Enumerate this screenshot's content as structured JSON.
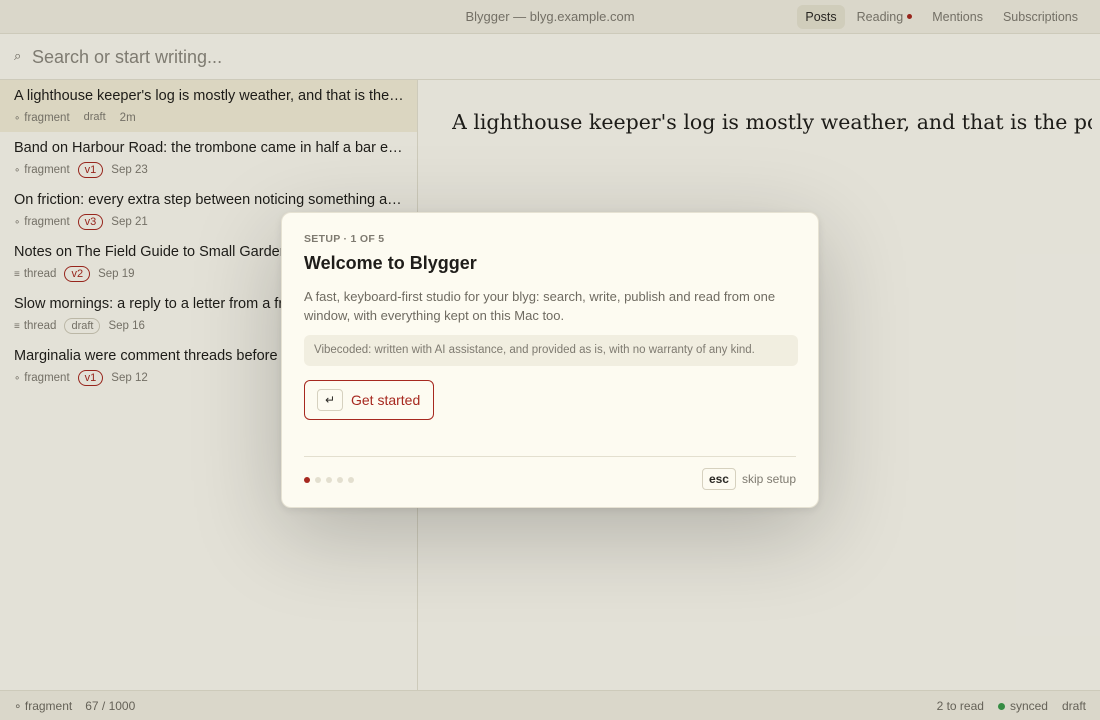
{
  "window": {
    "title": "Blygger — blyg.example.com"
  },
  "nav": {
    "tabs": [
      {
        "label": "Posts",
        "active": true
      },
      {
        "label": "Reading",
        "unread_indicator": true
      },
      {
        "label": "Mentions"
      },
      {
        "label": "Subscriptions"
      }
    ]
  },
  "search": {
    "placeholder": "Search or start writing...",
    "icon": "search-icon",
    "glyph": "⌕"
  },
  "posts": [
    {
      "title": "A lighthouse keeper's log is mostly weather, and that is the point.",
      "type_glyph": "∘",
      "type": "fragment",
      "status": "draft",
      "status_style": "label",
      "date": "2m",
      "selected": true
    },
    {
      "title": "Band on Harbour Road: the trombone came in half a bar early",
      "type_glyph": "∘",
      "type": "fragment",
      "status": "v1",
      "status_style": "version",
      "date": "Sep 23"
    },
    {
      "title": "On friction: every extra step between noticing something and writing it",
      "type_glyph": "∘",
      "type": "fragment",
      "status": "v3",
      "status_style": "version",
      "date": "Sep 21"
    },
    {
      "title": "Notes on The Field Guide to Small Gardens",
      "type_glyph": "≡",
      "type": "thread",
      "status": "v2",
      "status_style": "version",
      "date": "Sep 19"
    },
    {
      "title": "Slow mornings: a reply to a letter from a friend",
      "type_glyph": "≡",
      "type": "thread",
      "status": "draft",
      "status_style": "pill",
      "date": "Sep 16"
    },
    {
      "title": "Marginalia were comment threads before the web",
      "type_glyph": "∘",
      "type": "fragment",
      "status": "v1",
      "status_style": "version",
      "date": "Sep 12"
    }
  ],
  "reader": {
    "title": "A lighthouse keeper's log is mostly weather, and that is the point."
  },
  "status": {
    "type_glyph": "∘",
    "type": "fragment",
    "char_count": "67 / 1000",
    "to_read": "2 to read",
    "sync": "synced",
    "state": "draft"
  },
  "modal": {
    "step": "SETUP · 1 OF 5",
    "title": "Welcome to Blygger",
    "description": "A fast, keyboard-first studio for your blyg: search, write, publish and read from one window, with everything kept on this Mac too.",
    "disclaimer": "Vibecoded: written with AI assistance, and provided as is, with no warranty of any kind.",
    "primary_key": "↵",
    "primary_label": "Get started",
    "progress": {
      "current": 1,
      "total": 5
    },
    "skip_key": "esc",
    "skip_label": "skip setup"
  },
  "colors": {
    "accent": "#a6281f",
    "background": "#fbf9ef",
    "bar": "#f1eee0",
    "selected_row": "#f2edd6",
    "sync_ok": "#3a9a4a"
  }
}
